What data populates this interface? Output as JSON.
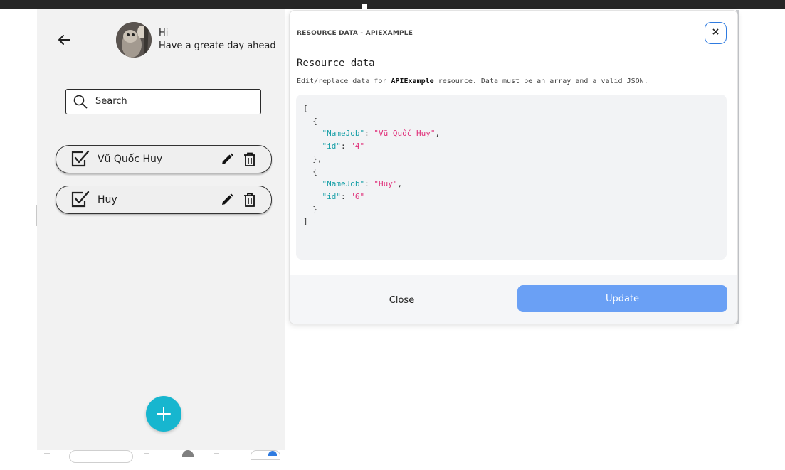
{
  "app": {
    "greeting": "Hi",
    "subtitle": "Have a greate day ahead",
    "search_placeholder": "Search",
    "tasks": [
      {
        "label": "Vũ Quốc Huy"
      },
      {
        "label": "Huy"
      }
    ],
    "add_label": "+"
  },
  "modal": {
    "title": "RESOURCE DATA - APIEXAMPLE",
    "close_icon_label": "×",
    "heading": "Resource data",
    "desc_prefix": "Edit/replace data for ",
    "desc_resource": "APIExample",
    "desc_suffix": " resource. Data must be an array and a valid JSON.",
    "json": [
      {
        "NameJob": "Vũ Quốc Huy",
        "id": "4"
      },
      {
        "NameJob": "Huy",
        "id": "6"
      }
    ],
    "close_label": "Close",
    "update_label": "Update"
  },
  "colors": {
    "accent": "#2f7be0",
    "update_button": "#6aa0f5",
    "fab": "#17b6cf",
    "json_key": "#1aa0a8",
    "json_string": "#e0307a"
  },
  "icons": [
    "arrow-left-icon",
    "search-icon",
    "checkbox-checked-icon",
    "pencil-icon",
    "trash-icon",
    "plus-icon",
    "close-icon"
  ]
}
